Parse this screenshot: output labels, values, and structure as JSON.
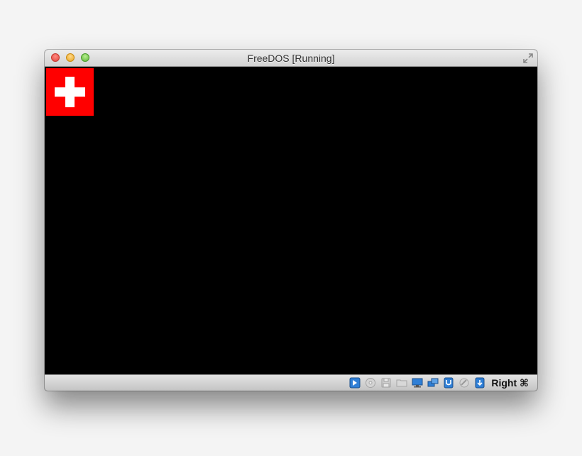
{
  "window": {
    "title": "FreeDOS [Running]"
  },
  "screen": {
    "logo": {
      "name": "swiss-flag",
      "colors": {
        "background": "#ff0000",
        "cross": "#ffffff"
      }
    }
  },
  "statusbar": {
    "indicators": [
      {
        "name": "hard-disk",
        "icon": "hard-disk-icon",
        "active": true
      },
      {
        "name": "optical-drive",
        "icon": "cd-icon",
        "active": false
      },
      {
        "name": "floppy",
        "icon": "floppy-icon",
        "active": false
      },
      {
        "name": "shared-folders",
        "icon": "folder-icon",
        "active": false
      },
      {
        "name": "display",
        "icon": "display-icon",
        "active": true
      },
      {
        "name": "network",
        "icon": "network-icon",
        "active": true
      },
      {
        "name": "usb",
        "icon": "usb-icon",
        "active": true
      },
      {
        "name": "video-capture",
        "icon": "capture-icon",
        "active": false
      },
      {
        "name": "mouse-integration",
        "icon": "mouse-icon",
        "active": true
      }
    ],
    "host_key": "Right ⌘"
  },
  "colors": {
    "accent_blue": "#2f7fd6",
    "screen_bg": "#000000"
  }
}
